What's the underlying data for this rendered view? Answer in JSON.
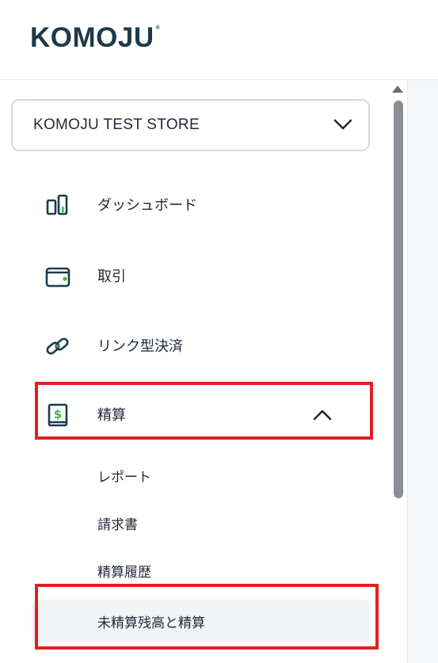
{
  "brand": {
    "logo_text": "KOMOJU",
    "logo_reg": "®"
  },
  "store_selector": {
    "value": "KOMOJU TEST STORE",
    "icon": "chevron-down-icon"
  },
  "nav": {
    "dashboard": {
      "label": "ダッシュボード",
      "icon": "dashboard-icon"
    },
    "transactions": {
      "label": "取引",
      "icon": "wallet-icon"
    },
    "payment_links": {
      "label": "リンク型決済",
      "icon": "link-icon"
    },
    "settlement": {
      "label": "精算",
      "icon": "settlement-icon",
      "expanded": true
    }
  },
  "settlement_sub": {
    "reports": "レポート",
    "invoices": "請求書",
    "history": "精算履歴",
    "unsettled": "未精算残高と精算"
  },
  "colors": {
    "accent": "#3dbb3d",
    "highlight": "#e02020",
    "text": "#1f2a37"
  }
}
